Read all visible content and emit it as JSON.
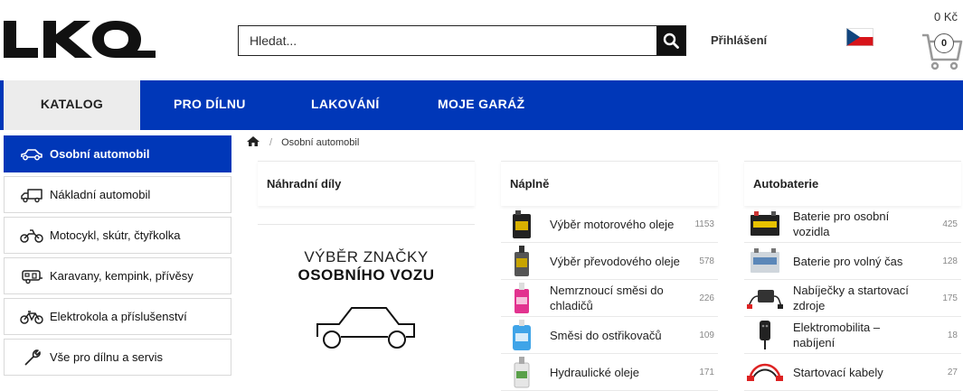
{
  "brand": {
    "logo_text": "LKQ"
  },
  "header": {
    "search_placeholder": "Hledat...",
    "login_label": "Přihlášení",
    "cart_total": "0 Kč",
    "cart_count": "0"
  },
  "nav": {
    "items": [
      "KATALOG",
      "PRO DÍLNU",
      "LAKOVÁNÍ",
      "MOJE GARÁŽ"
    ]
  },
  "sidebar": {
    "items": [
      {
        "label": "Osobní automobil",
        "icon": "car-icon"
      },
      {
        "label": "Nákladní automobil",
        "icon": "truck-icon"
      },
      {
        "label": "Motocykl, skútr, čtyřkolka",
        "icon": "motorcycle-icon"
      },
      {
        "label": "Karavany, kempink, přívěsy",
        "icon": "caravan-icon"
      },
      {
        "label": "Elektrokola a příslušenství",
        "icon": "bicycle-icon"
      },
      {
        "label": "Vše pro dílnu a servis",
        "icon": "wrench-icon"
      }
    ]
  },
  "breadcrumb": {
    "current": "Osobní automobil"
  },
  "columns": {
    "parts": {
      "title": "Náhradní díly",
      "car_selector_line1": "VÝBĚR ZNAČKY",
      "car_selector_line2": "OSOBNÍHO VOZU"
    },
    "fluids": {
      "title": "Náplně",
      "items": [
        {
          "name": "Výběr motorového oleje",
          "count": "1153"
        },
        {
          "name": "Výběr převodového oleje",
          "count": "578"
        },
        {
          "name": "Nemrznoucí směsi do chladičů",
          "count": "226"
        },
        {
          "name": "Směsi do ostřikovačů",
          "count": "109"
        },
        {
          "name": "Hydraulické oleje",
          "count": "171"
        }
      ]
    },
    "batteries": {
      "title": "Autobaterie",
      "items": [
        {
          "name": "Baterie pro osobní vozidla",
          "count": "425"
        },
        {
          "name": "Baterie pro volný čas",
          "count": "128"
        },
        {
          "name": "Nabíječky a startovací zdroje",
          "count": "175"
        },
        {
          "name": "Elektromobilita – nabíjení",
          "count": "18"
        },
        {
          "name": "Startovací kabely",
          "count": "27"
        }
      ]
    }
  },
  "colors": {
    "brand_blue": "#0037b8",
    "active_tab_bg": "#ececec"
  }
}
